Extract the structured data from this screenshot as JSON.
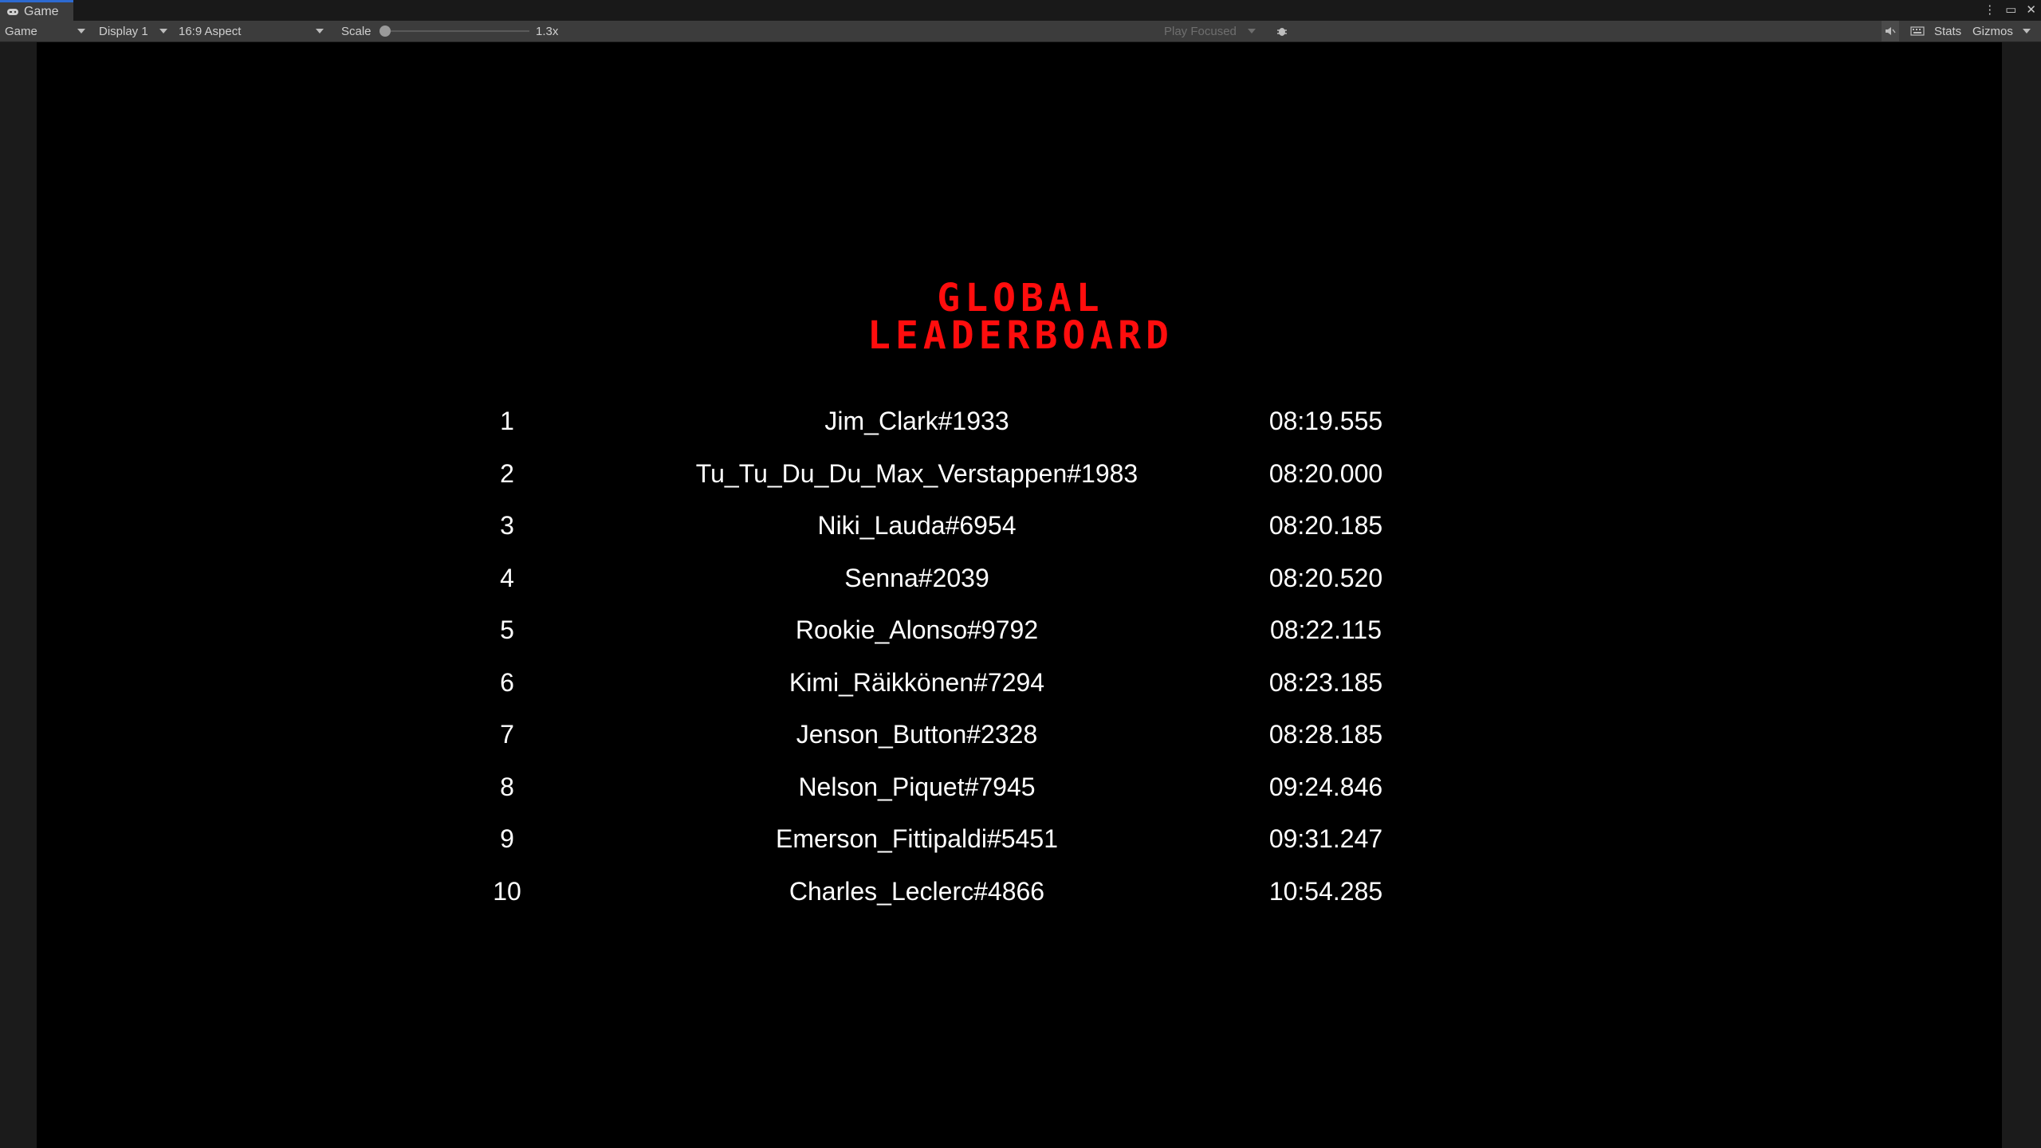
{
  "tab": {
    "label": "Game",
    "icon": "gamepad-icon"
  },
  "toolbar": {
    "mode": "Game",
    "display": "Display 1",
    "aspect": "16:9 Aspect",
    "scale_label": "Scale",
    "scale_value": "1.3x",
    "play_focused": "Play Focused",
    "stats": "Stats",
    "gizmos": "Gizmos"
  },
  "leaderboard": {
    "title_line1": "GLOBAL",
    "title_line2": "LEADERBOARD",
    "title_color": "#ff0d0d",
    "rows": [
      {
        "rank": "1",
        "name": "Jim_Clark#1933",
        "time": "08:19.555"
      },
      {
        "rank": "2",
        "name": "Tu_Tu_Du_Du_Max_Verstappen#1983",
        "time": "08:20.000"
      },
      {
        "rank": "3",
        "name": "Niki_Lauda#6954",
        "time": "08:20.185"
      },
      {
        "rank": "4",
        "name": "Senna#2039",
        "time": "08:20.520"
      },
      {
        "rank": "5",
        "name": "Rookie_Alonso#9792",
        "time": "08:22.115"
      },
      {
        "rank": "6",
        "name": "Kimi_Räikkönen#7294",
        "time": "08:23.185"
      },
      {
        "rank": "7",
        "name": "Jenson_Button#2328",
        "time": "08:28.185"
      },
      {
        "rank": "8",
        "name": "Nelson_Piquet#7945",
        "time": "09:24.846"
      },
      {
        "rank": "9",
        "name": "Emerson_Fittipaldi#5451",
        "time": "09:31.247"
      },
      {
        "rank": "10",
        "name": "Charles_Leclerc#4866",
        "time": "10:54.285"
      }
    ]
  }
}
